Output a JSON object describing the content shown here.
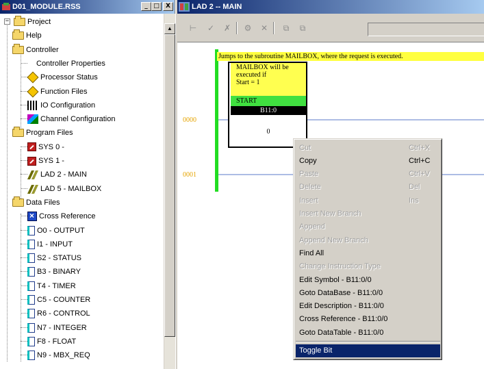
{
  "project_window": {
    "title": "D01_MODULE.RSS",
    "min_label": "_",
    "max_label": "□",
    "close_label": "X",
    "tree": [
      {
        "label": "Project",
        "icon": "folder-icon",
        "level": 0,
        "expander": "-"
      },
      {
        "label": "Help",
        "icon": "folder-icon",
        "level": 1,
        "expander": "+"
      },
      {
        "label": "Controller",
        "icon": "folder-icon",
        "level": 1,
        "expander": "-"
      },
      {
        "label": "Controller Properties",
        "icon": "info-icon",
        "level": 2
      },
      {
        "label": "Processor Status",
        "icon": "diamond-icon",
        "level": 2
      },
      {
        "label": "Function Files",
        "icon": "diamond-icon",
        "level": 2
      },
      {
        "label": "IO Configuration",
        "icon": "io-icon",
        "level": 2
      },
      {
        "label": "Channel Configuration",
        "icon": "chan-icon",
        "level": 2
      },
      {
        "label": "Program Files",
        "icon": "folder-icon",
        "level": 1,
        "expander": "-"
      },
      {
        "label": "SYS 0 -",
        "icon": "sys-icon",
        "level": 2
      },
      {
        "label": "SYS 1 -",
        "icon": "sys-icon",
        "level": 2
      },
      {
        "label": "LAD 2 - MAIN",
        "icon": "lad-icon",
        "level": 2
      },
      {
        "label": "LAD 5 - MAILBOX",
        "icon": "lad-icon",
        "level": 2
      },
      {
        "label": "Data Files",
        "icon": "folder-icon",
        "level": 1,
        "expander": "-"
      },
      {
        "label": "Cross Reference",
        "icon": "xref-icon",
        "level": 2
      },
      {
        "label": "O0 - OUTPUT",
        "icon": "file-icon",
        "level": 2
      },
      {
        "label": "I1 - INPUT",
        "icon": "file-icon",
        "level": 2
      },
      {
        "label": "S2 - STATUS",
        "icon": "file-icon",
        "level": 2
      },
      {
        "label": "B3 - BINARY",
        "icon": "file-icon",
        "level": 2
      },
      {
        "label": "T4 - TIMER",
        "icon": "file-icon",
        "level": 2
      },
      {
        "label": "C5 - COUNTER",
        "icon": "file-icon",
        "level": 2
      },
      {
        "label": "R6 - CONTROL",
        "icon": "file-icon",
        "level": 2
      },
      {
        "label": "N7 - INTEGER",
        "icon": "file-icon",
        "level": 2
      },
      {
        "label": "F8 - FLOAT",
        "icon": "file-icon",
        "level": 2
      },
      {
        "label": "N9 - MBX_REQ",
        "icon": "file-icon",
        "level": 2
      }
    ]
  },
  "ladder_window": {
    "title": "LAD 2 -- MAIN",
    "toolbar_icons": [
      "insert-rung-icon",
      "accept-edits-icon",
      "cancel-edits-icon",
      "verify-icon",
      "delete-icon",
      "zoom-in-icon",
      "zoom-out-icon"
    ],
    "rung_comment": "Jumps to the subroutine MAILBOX, where the request is executed.",
    "instruction": {
      "comment_lines": [
        "MAILBOX will be",
        "executed if",
        "Start = 1"
      ],
      "symbol": "START",
      "address": "B11:0",
      "bit": "0"
    },
    "rungs": [
      "0000",
      "0001"
    ]
  },
  "context_menu": {
    "items": [
      {
        "label": "Cut",
        "shortcut": "Ctrl+X",
        "enabled": false
      },
      {
        "label": "Copy",
        "shortcut": "Ctrl+C",
        "enabled": true
      },
      {
        "label": "Paste",
        "shortcut": "Ctrl+V",
        "enabled": false
      },
      {
        "label": "Delete",
        "shortcut": "Del",
        "enabled": false
      },
      {
        "label": "Insert",
        "shortcut": "Ins",
        "enabled": false
      },
      {
        "label": "Insert New Branch",
        "shortcut": "",
        "enabled": false
      },
      {
        "label": "Append",
        "shortcut": "",
        "enabled": false
      },
      {
        "label": "Append New Branch",
        "shortcut": "",
        "enabled": false
      },
      {
        "label": "Find All",
        "shortcut": "",
        "enabled": true
      },
      {
        "label": "Change Instruction Type",
        "shortcut": "",
        "enabled": false
      },
      {
        "label": "Edit Symbol - B11:0/0",
        "shortcut": "",
        "enabled": true
      },
      {
        "label": "Goto DataBase - B11:0/0",
        "shortcut": "",
        "enabled": true
      },
      {
        "label": "Edit Description - B11:0/0",
        "shortcut": "",
        "enabled": true
      },
      {
        "label": "Cross Reference - B11:0/0",
        "shortcut": "",
        "enabled": true
      },
      {
        "label": "Goto DataTable - B11:0/0",
        "shortcut": "",
        "enabled": true
      },
      {
        "label": "Toggle Bit",
        "shortcut": "",
        "enabled": true,
        "highlighted": true
      }
    ]
  },
  "colors": {
    "title_start": "#0a246a",
    "title_end": "#a6caf0",
    "comment_yellow": "#ffff40",
    "symbol_green": "#40e040",
    "rail_green": "#22dd22",
    "rung_blue": "#5a78c8",
    "rung_number": "#e6a400",
    "menu_highlight": "#0a246a"
  }
}
